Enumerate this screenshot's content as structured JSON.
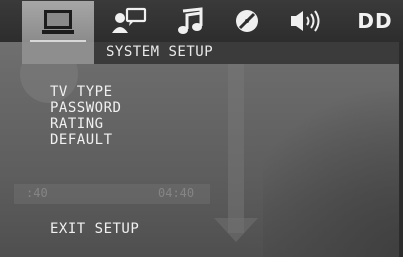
{
  "tabs": [
    {
      "icon": "tv-monitor-icon",
      "active": true
    },
    {
      "icon": "person-speech-icon",
      "active": false
    },
    {
      "icon": "music-note-icon",
      "active": false
    },
    {
      "icon": "disc-slash-icon",
      "active": false
    },
    {
      "icon": "speaker-volume-icon",
      "active": false
    },
    {
      "icon": "dolby-digital-icon",
      "label": "DD",
      "active": false
    }
  ],
  "title": "SYSTEM SETUP",
  "menu": {
    "items": [
      {
        "label": "TV TYPE"
      },
      {
        "label": "PASSWORD"
      },
      {
        "label": "RATING"
      },
      {
        "label": "DEFAULT"
      }
    ],
    "exit_label": "EXIT SETUP"
  },
  "background_ghost": {
    "time_left": ":40",
    "time_right": "04:40"
  },
  "colors": {
    "tab_bar": "#2d2d2d",
    "active_tab": "#9a9a9a",
    "panel": "#6a6a6a",
    "text": "#f0f0f0"
  }
}
